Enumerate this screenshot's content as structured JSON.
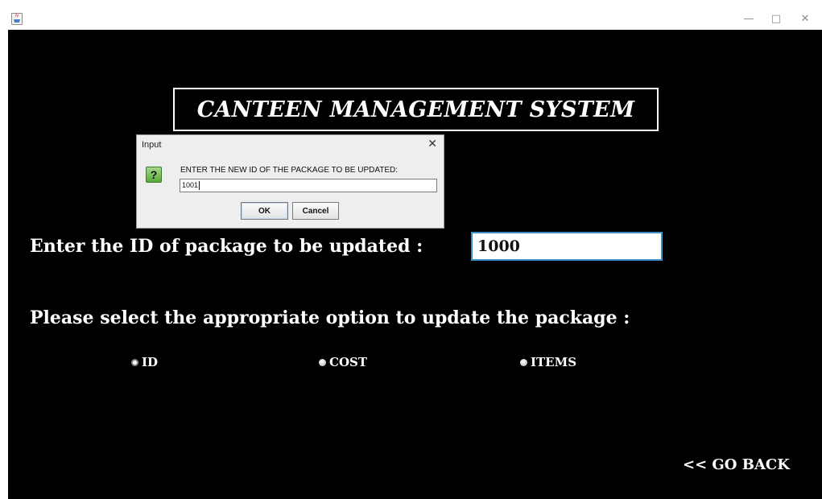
{
  "window": {
    "icon": "java-icon",
    "minimize_glyph": "—",
    "maximize_glyph": "□",
    "close_glyph": "✕"
  },
  "main": {
    "title": "CANTEEN MANAGEMENT SYSTEM",
    "enter_label": "Enter the ID of package to be updated :",
    "id_value": "1000",
    "select_label": "Please select the appropriate option to update the package :",
    "options": [
      {
        "label": "ID",
        "selected": false
      },
      {
        "label": "COST",
        "selected": false
      },
      {
        "label": "ITEMS",
        "selected": false
      }
    ],
    "go_back": "<< GO BACK"
  },
  "dialog": {
    "title": "Input",
    "close_glyph": "✕",
    "icon_glyph": "?",
    "message": "ENTER THE NEW ID OF THE PACKAGE TO BE UPDATED:",
    "input_value": "1001",
    "ok_label": "OK",
    "cancel_label": "Cancel"
  },
  "colors": {
    "background": "#000000",
    "text": "#ffffff",
    "field_border": "#3a8fc7",
    "dialog_bg": "#eeeeee"
  }
}
